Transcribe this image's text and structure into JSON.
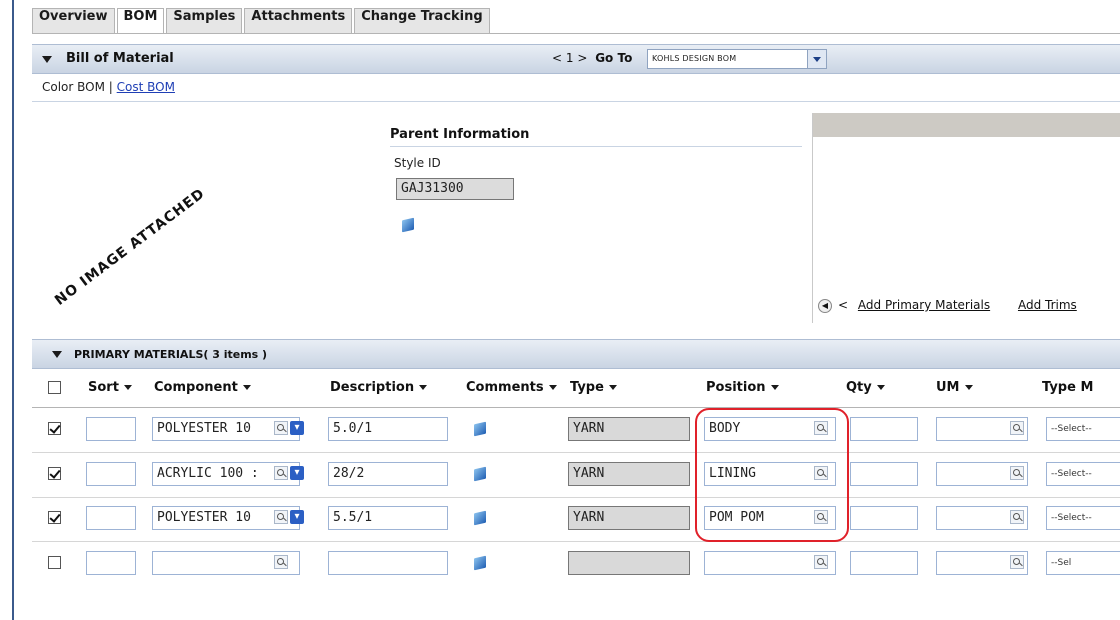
{
  "tabs": [
    "Overview",
    "BOM",
    "Samples",
    "Attachments",
    "Change Tracking"
  ],
  "bom_section": {
    "title": "Bill of Material",
    "pager": "< 1 >",
    "goto_label": "Go To",
    "goto_value": "KOHLS DESIGN BOM"
  },
  "bom_links": {
    "color_bom": "Color BOM",
    "separator": "|",
    "cost_bom": "Cost BOM"
  },
  "no_image_text": "NO IMAGE ATTACHED",
  "parent_info": {
    "title": "Parent Information",
    "style_id_label": "Style ID",
    "style_id_value": "GAJ31300"
  },
  "right_panel": {
    "prev": "<",
    "add_primary": "Add Primary Materials",
    "add_trims": "Add Trims"
  },
  "primary_section": {
    "title": "PRIMARY MATERIALS( 3 items )"
  },
  "columns": {
    "sort": "Sort",
    "component": "Component",
    "description": "Description",
    "comments": "Comments",
    "type": "Type",
    "position": "Position",
    "qty": "Qty",
    "um": "UM",
    "type_m": "Type M"
  },
  "rows": [
    {
      "checked": true,
      "sort": "",
      "component": "POLYESTER 10",
      "description": "5.0/1",
      "type": "YARN",
      "position": "BODY",
      "qty": "",
      "um": "",
      "select": "--Select--"
    },
    {
      "checked": true,
      "sort": "",
      "component": "ACRYLIC 100 :",
      "description": "28/2",
      "type": "YARN",
      "position": "LINING",
      "qty": "",
      "um": "",
      "select": "--Select--"
    },
    {
      "checked": true,
      "sort": "",
      "component": "POLYESTER 10",
      "description": "5.5/1",
      "type": "YARN",
      "position": "POM POM",
      "qty": "",
      "um": "",
      "select": "--Select--"
    },
    {
      "checked": false,
      "sort": "",
      "component": "",
      "description": "",
      "type": "",
      "position": "",
      "qty": "",
      "um": "",
      "select": "--Sel"
    }
  ],
  "icons": {
    "lookup": "search-icon",
    "info": "info-icon",
    "comment": "comment-icon",
    "checkbox": "checkbox-icon"
  },
  "colors": {
    "section_bar": "#c9d4e3",
    "link": "#1f3fb5",
    "highlight": "#e0212a"
  }
}
